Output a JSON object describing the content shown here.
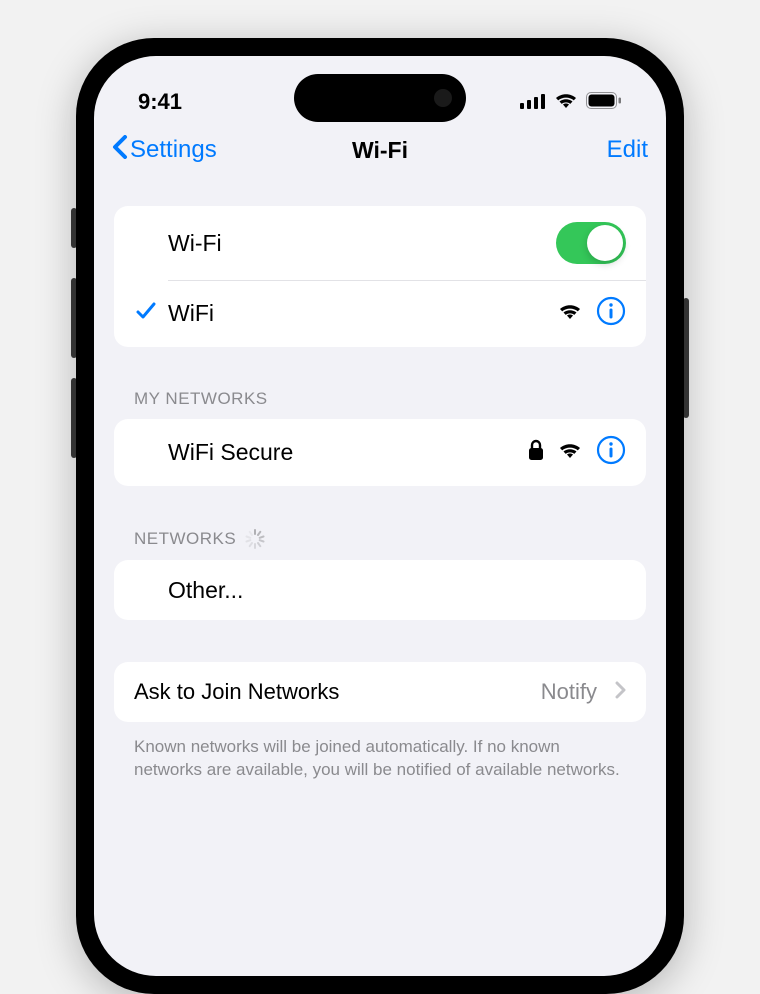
{
  "status": {
    "time": "9:41"
  },
  "nav": {
    "back_label": "Settings",
    "title": "Wi-Fi",
    "edit_label": "Edit"
  },
  "wifi": {
    "toggle_label": "Wi-Fi",
    "toggle_on": true,
    "connected_network": "WiFi"
  },
  "sections": {
    "my_networks_label": "MY NETWORKS",
    "my_networks": [
      {
        "name": "WiFi Secure",
        "locked": true
      }
    ],
    "networks_label": "NETWORKS",
    "other_label": "Other..."
  },
  "ask_join": {
    "label": "Ask to Join Networks",
    "value": "Notify",
    "footer": "Known networks will be joined automatically. If no known networks are available, you will be notified of available networks."
  }
}
